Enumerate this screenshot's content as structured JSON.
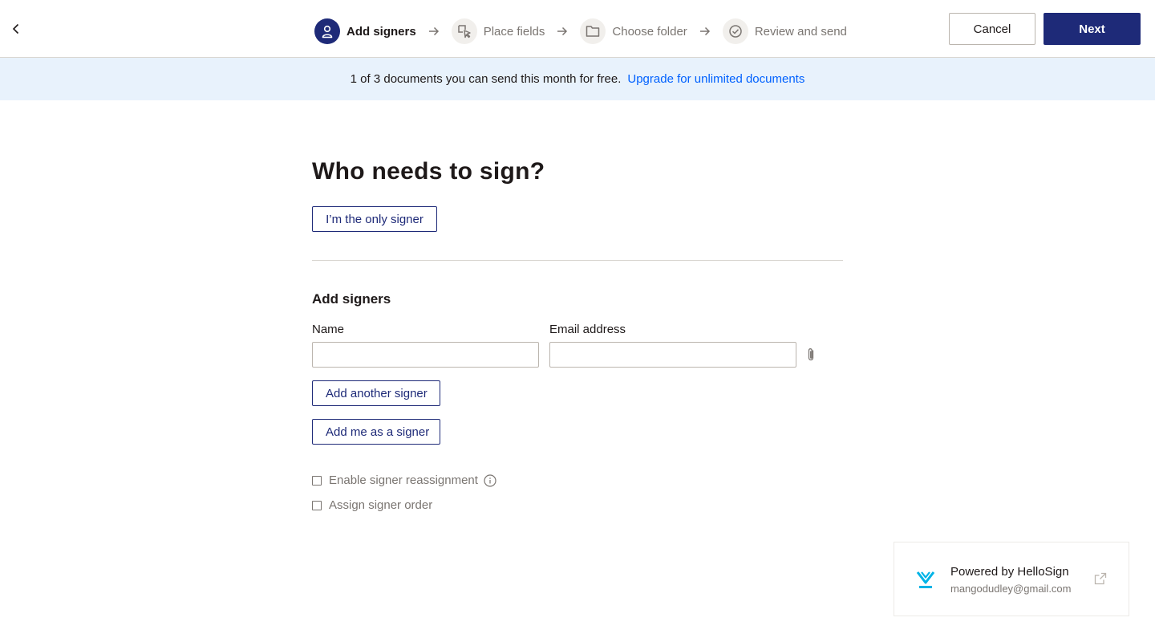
{
  "header": {
    "steps": [
      {
        "label": "Add signers",
        "icon": "person-icon",
        "active": true
      },
      {
        "label": "Place fields",
        "icon": "cursor-field-icon",
        "active": false
      },
      {
        "label": "Choose folder",
        "icon": "folder-icon",
        "active": false
      },
      {
        "label": "Review and send",
        "icon": "check-circle-icon",
        "active": false
      }
    ],
    "cancel_label": "Cancel",
    "next_label": "Next"
  },
  "banner": {
    "text": "1 of 3 documents you can send this month for free.",
    "link": "Upgrade for unlimited documents"
  },
  "main": {
    "title": "Who needs to sign?",
    "only_signer_label": "I’m the only signer",
    "section_title": "Add signers",
    "name_label": "Name",
    "name_value": "",
    "email_label": "Email address",
    "email_value": "",
    "add_another_label": "Add another signer",
    "add_me_label": "Add me as a signer",
    "options": [
      {
        "label": "Enable signer reassignment",
        "checked": false
      },
      {
        "label": "Assign signer order",
        "checked": false
      }
    ]
  },
  "powered": {
    "title": "Powered by HelloSign",
    "email": "mangodudley@gmail.com"
  },
  "colors": {
    "primary": "#1e2a78",
    "link": "#0061fe",
    "banner_bg": "#e8f2fc",
    "logo": "#00b3e6"
  }
}
